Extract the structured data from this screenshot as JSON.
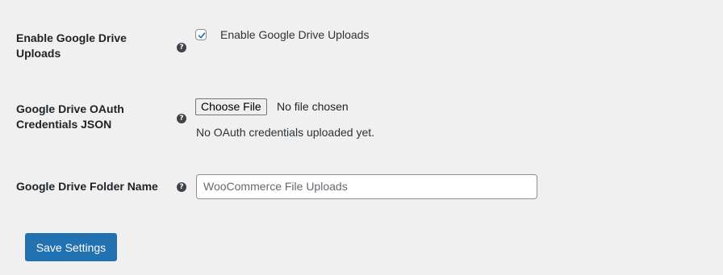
{
  "settings": {
    "enable_uploads": {
      "label": "Enable Google Drive Uploads",
      "help_icon": "?",
      "checkbox_checked": true,
      "checkbox_label": "Enable Google Drive Uploads"
    },
    "oauth_credentials": {
      "label": "Google Drive OAuth Credentials JSON",
      "help_icon": "?",
      "choose_file_label": "Choose File",
      "file_status": "No file chosen",
      "description": "No OAuth credentials uploaded yet."
    },
    "folder_name": {
      "label": "Google Drive Folder Name",
      "help_icon": "?",
      "value": "WooCommerce File Uploads"
    }
  },
  "actions": {
    "save_label": "Save Settings"
  },
  "colors": {
    "background": "#f0f0f1",
    "primary_button": "#2271b1",
    "checkbox_check": "#2271b1"
  }
}
